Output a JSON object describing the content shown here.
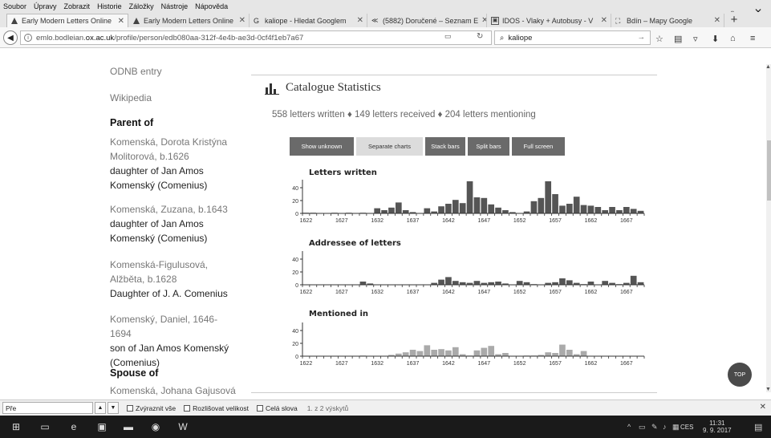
{
  "menu": [
    "Soubor",
    "Úpravy",
    "Zobrazit",
    "Historie",
    "Záložky",
    "Nástroje",
    "Nápověda"
  ],
  "tabs": [
    {
      "label": "Early Modern Letters Online",
      "active": true
    },
    {
      "label": "Early Modern Letters Online",
      "active": false
    },
    {
      "label": "kaliope - Hledat Googlem",
      "active": false
    },
    {
      "label": "(5882) Doručené – Seznam E",
      "active": false
    },
    {
      "label": "IDOS - Vlaky + Autobusy - V",
      "active": false
    },
    {
      "label": "Bdín – Mapy Google",
      "active": false
    }
  ],
  "url": {
    "prefix": "emlo.bodleian.",
    "domain": "ox.ac.uk",
    "path": "/profile/person/edb080aa-312f-4e4b-ae3d-0cf4f1eb7a67"
  },
  "search": {
    "value": "kaliope"
  },
  "sidebar": {
    "odnb": "ODNB entry",
    "wikipedia": "Wikipedia",
    "parent_heading": "Parent of",
    "entries": [
      {
        "name": "Komenská, Dorota Kristýna Molitorová, b.1626",
        "rel": "daughter of Jan Amos Komenský (Comenius)"
      },
      {
        "name": "Komenská, Zuzana, b.1643",
        "rel": "daughter of Jan Amos Komenský (Comenius)"
      },
      {
        "name": "Komenská-Figulusová, Alžběta, b.1628",
        "rel": "Daughter of J. A. Comenius"
      },
      {
        "name": "Komenský, Daniel, 1646-1694",
        "rel": "son of Jan Amos Komenský (Comenius)"
      }
    ],
    "spouse_heading": "Spouse of",
    "spouse": "Komenská, Johana Gajusová"
  },
  "stats": {
    "title": "Catalogue Statistics",
    "summary": "558 letters written ♦ 149 letters received ♦ 204 letters mentioning",
    "buttons": [
      "Show unknown",
      "Separate charts",
      "Stack bars",
      "Split bars",
      "Full screen"
    ],
    "selected_button": "Separate charts"
  },
  "chart_data": [
    {
      "type": "bar",
      "title": "Letters written",
      "color": "#555555",
      "x_start": 1622,
      "x_end": 1670,
      "x_ticks": [
        1622,
        1627,
        1632,
        1637,
        1642,
        1647,
        1652,
        1657,
        1662,
        1667
      ],
      "y_ticks": [
        0,
        20,
        40
      ],
      "ylim": [
        0,
        55
      ],
      "values": [
        1,
        1,
        0,
        0,
        1,
        0,
        1,
        0,
        1,
        0,
        8,
        5,
        9,
        17,
        5,
        2,
        0,
        8,
        3,
        11,
        15,
        21,
        16,
        50,
        25,
        24,
        14,
        9,
        5,
        2,
        0,
        3,
        19,
        24,
        50,
        30,
        12,
        15,
        26,
        13,
        12,
        10,
        5,
        10,
        5,
        10,
        7,
        4
      ]
    },
    {
      "type": "bar",
      "title": "Addressee of letters",
      "color": "#555555",
      "x_start": 1622,
      "x_end": 1670,
      "x_ticks": [
        1622,
        1627,
        1632,
        1637,
        1642,
        1647,
        1652,
        1657,
        1662,
        1667
      ],
      "y_ticks": [
        0,
        20,
        40
      ],
      "ylim": [
        0,
        55
      ],
      "values": [
        0,
        0,
        0,
        0,
        0,
        0,
        0,
        0,
        5,
        2,
        0,
        0,
        0,
        0,
        0,
        0,
        0,
        0,
        3,
        8,
        12,
        6,
        4,
        3,
        6,
        3,
        4,
        5,
        2,
        0,
        6,
        4,
        1,
        0,
        3,
        4,
        10,
        7,
        3,
        1,
        5,
        0,
        6,
        3,
        1,
        3,
        14,
        4
      ]
    },
    {
      "type": "bar",
      "title": "Mentioned in",
      "color": "#aaaaaa",
      "x_start": 1622,
      "x_end": 1670,
      "x_ticks": [
        1622,
        1627,
        1632,
        1637,
        1642,
        1647,
        1652,
        1657,
        1662,
        1667
      ],
      "y_ticks": [
        0,
        20,
        40
      ],
      "ylim": [
        0,
        55
      ],
      "values": [
        0,
        0,
        0,
        0,
        0,
        0,
        0,
        0,
        1,
        0,
        0,
        0,
        2,
        4,
        6,
        10,
        8,
        17,
        10,
        11,
        9,
        14,
        3,
        1,
        9,
        13,
        16,
        3,
        5,
        0,
        0,
        1,
        1,
        2,
        6,
        5,
        18,
        10,
        3,
        8,
        0,
        0,
        0,
        0,
        0,
        0,
        0,
        0
      ]
    }
  ],
  "top_button": "TOP",
  "findbar": {
    "value": "Pře",
    "highlight_all": "Zvýraznit vše",
    "match_case": "Rozlišovat velikost",
    "whole_words": "Celá slova",
    "status": "1. z 2 výskytů"
  },
  "taskbar": {
    "lang": "CES",
    "time": "11:31",
    "date": "9. 9. 2017"
  }
}
